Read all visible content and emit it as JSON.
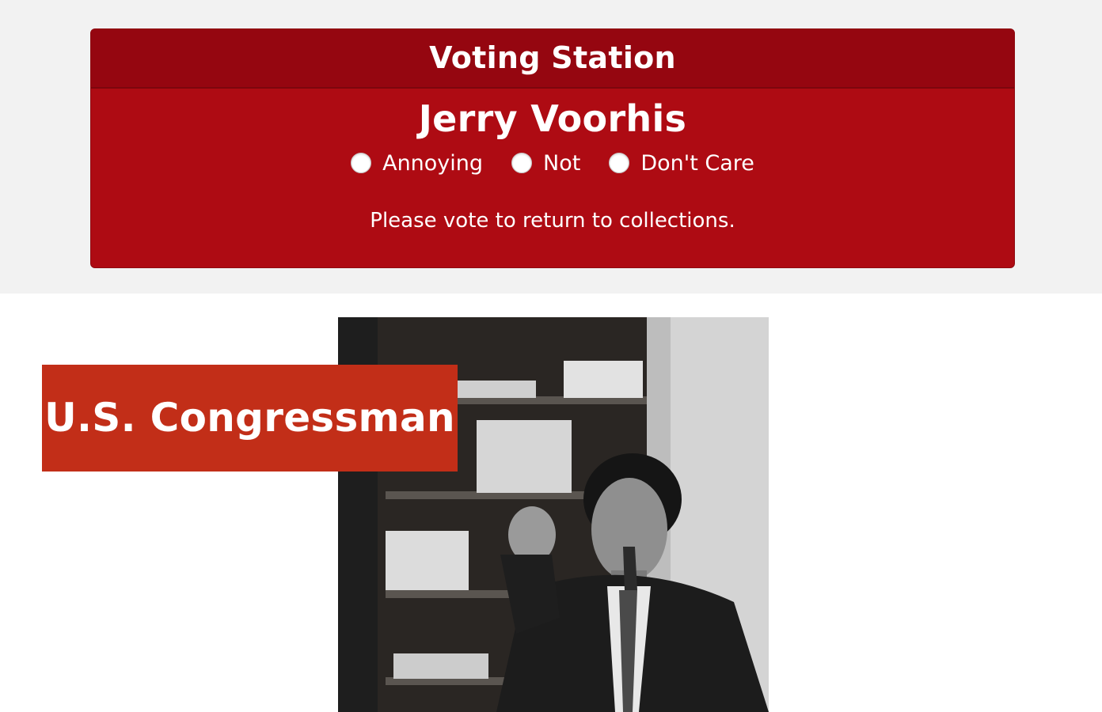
{
  "voting": {
    "header": "Voting Station",
    "candidate": "Jerry Voorhis",
    "options": [
      {
        "label": "Annoying"
      },
      {
        "label": "Not"
      },
      {
        "label": "Don't Care"
      }
    ],
    "message": "Please vote to return to collections."
  },
  "profile": {
    "title_badge": "U.S. Congressman",
    "photo_description": "black-and-white-portrait"
  },
  "colors": {
    "panel": "#ae0b13",
    "panel_header": "#950610",
    "badge": "#c22e18",
    "band": "#f2f2f2"
  }
}
